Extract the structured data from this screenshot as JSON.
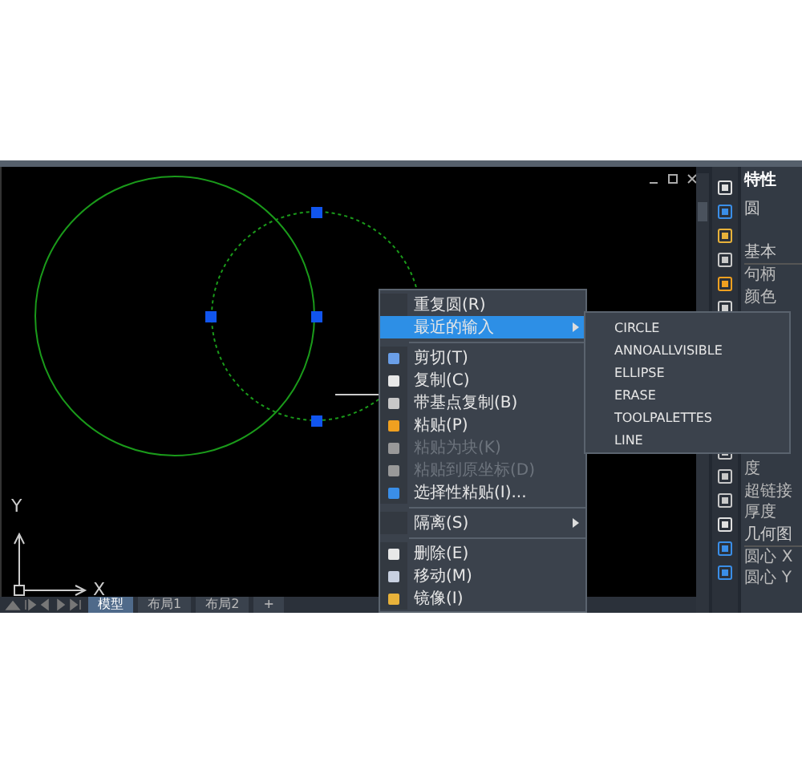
{
  "canvas": {
    "axis_labels": {
      "y": "Y",
      "x": "X"
    }
  },
  "context_menu": {
    "items": [
      {
        "kind": "item",
        "label": "重复圆(R)",
        "disabled": false,
        "selected": false,
        "submenu": false
      },
      {
        "kind": "item",
        "label": "最近的输入",
        "disabled": false,
        "selected": true,
        "submenu": true
      },
      {
        "kind": "separator"
      },
      {
        "kind": "item",
        "label": "剪切(T)",
        "disabled": false,
        "selected": false,
        "submenu": false
      },
      {
        "kind": "item",
        "label": "复制(C)",
        "disabled": false,
        "selected": false,
        "submenu": false
      },
      {
        "kind": "item",
        "label": "带基点复制(B)",
        "disabled": false,
        "selected": false,
        "submenu": false
      },
      {
        "kind": "item",
        "label": "粘贴(P)",
        "disabled": false,
        "selected": false,
        "submenu": false
      },
      {
        "kind": "item",
        "label": "粘贴为块(K)",
        "disabled": true,
        "selected": false,
        "submenu": false
      },
      {
        "kind": "item",
        "label": "粘贴到原坐标(D)",
        "disabled": true,
        "selected": false,
        "submenu": false
      },
      {
        "kind": "item",
        "label": "选择性粘贴(I)...",
        "disabled": false,
        "selected": false,
        "submenu": false
      },
      {
        "kind": "separator"
      },
      {
        "kind": "item",
        "label": "隔离(S)",
        "disabled": false,
        "selected": false,
        "submenu": true
      },
      {
        "kind": "separator"
      },
      {
        "kind": "item",
        "label": "删除(E)",
        "disabled": false,
        "selected": false,
        "submenu": false
      },
      {
        "kind": "item",
        "label": "移动(M)",
        "disabled": false,
        "selected": false,
        "submenu": false
      },
      {
        "kind": "item",
        "label": "镜像(I)",
        "disabled": false,
        "selected": false,
        "submenu": false
      }
    ]
  },
  "submenu": {
    "items": [
      "CIRCLE",
      "ANNOALLVISIBLE",
      "ELLIPSE",
      "ERASE",
      "TOOLPALETTES",
      "LINE"
    ]
  },
  "properties": {
    "title": "特性",
    "object": "圆",
    "rows": [
      {
        "kind": "section",
        "label": "基本"
      },
      {
        "kind": "row",
        "label": "句柄"
      },
      {
        "kind": "row",
        "label": "颜色"
      },
      {
        "kind": "row",
        "label": "度"
      },
      {
        "kind": "row",
        "label": "超链接"
      },
      {
        "kind": "row",
        "label": "厚度"
      },
      {
        "kind": "section",
        "label": "几何图"
      },
      {
        "kind": "row",
        "label": "圆心 X"
      },
      {
        "kind": "row",
        "label": "圆心 Y"
      }
    ]
  },
  "layout_tabs": [
    {
      "label": "模型",
      "selected": true
    },
    {
      "label": "布局1",
      "selected": false
    },
    {
      "label": "布局2",
      "selected": false
    },
    {
      "label": "+",
      "selected": false
    }
  ]
}
